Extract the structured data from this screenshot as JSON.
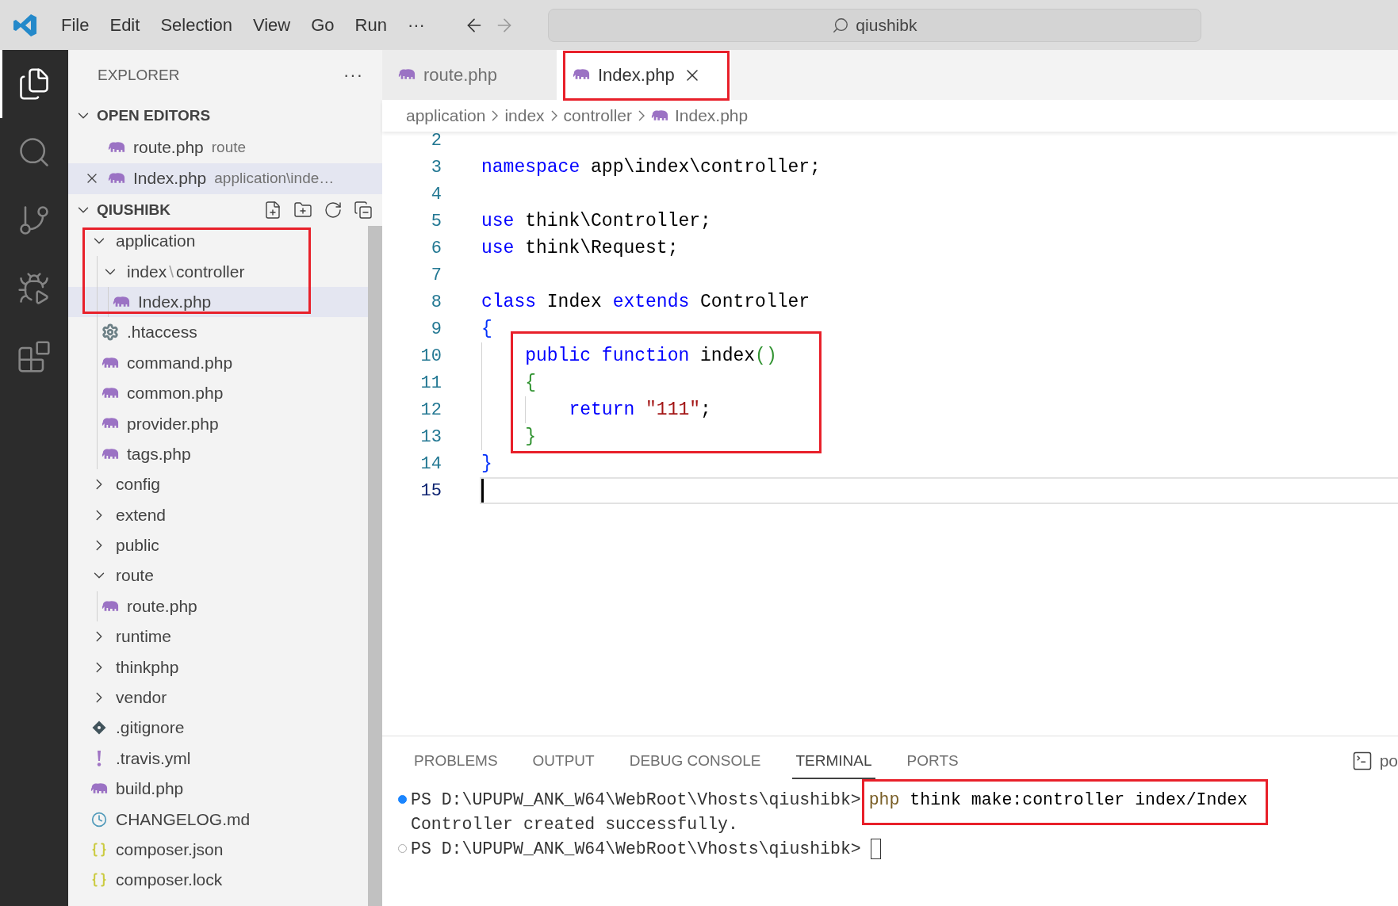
{
  "menu_bar": {
    "items": [
      "File",
      "Edit",
      "Selection",
      "View",
      "Go",
      "Run",
      "···"
    ],
    "search": {
      "value": "qiushibk"
    }
  },
  "activity_bar": [
    {
      "kind": "explorer",
      "selected": true
    },
    {
      "kind": "search",
      "selected": false
    },
    {
      "kind": "source-control",
      "selected": false
    },
    {
      "kind": "run-debug",
      "selected": false
    },
    {
      "kind": "extensions",
      "selected": false
    }
  ],
  "sidebar": {
    "title": "EXPLORER",
    "more": "···",
    "open_editors": {
      "title": "OPEN EDITORS",
      "expanded": true,
      "items": [
        {
          "name": "route.php",
          "description": "route",
          "active": false
        },
        {
          "name": "Index.php",
          "description": "application\\inde…",
          "active": true
        }
      ]
    },
    "folder": {
      "title": "QIUSHIBK",
      "expanded": true,
      "tree": [
        {
          "name": "application",
          "kind": "folder",
          "expanded": true,
          "selected": false,
          "annotated": true,
          "children": [
            {
              "segments": [
                "index",
                "\\",
                "controller"
              ],
              "kind": "folder",
              "expanded": true,
              "selected": false,
              "annotated": true,
              "children": [
                {
                  "name": "Index.php",
                  "kind": "php",
                  "selected": true,
                  "annotated": true
                }
              ]
            },
            {
              "name": ".htaccess",
              "kind": "gear",
              "selected": false,
              "annotated": false
            },
            {
              "name": "command.php",
              "kind": "php",
              "selected": false,
              "annotated": false
            },
            {
              "name": "common.php",
              "kind": "php",
              "selected": false,
              "annotated": false
            },
            {
              "name": "provider.php",
              "kind": "php",
              "selected": false,
              "annotated": false
            },
            {
              "name": "tags.php",
              "kind": "php",
              "selected": false,
              "annotated": false
            }
          ]
        },
        {
          "name": "config",
          "kind": "folder",
          "expanded": false,
          "selected": false,
          "annotated": false
        },
        {
          "name": "extend",
          "kind": "folder",
          "expanded": false,
          "selected": false,
          "annotated": false
        },
        {
          "name": "public",
          "kind": "folder",
          "expanded": false,
          "selected": false,
          "annotated": false
        },
        {
          "name": "route",
          "kind": "folder",
          "expanded": true,
          "selected": false,
          "annotated": false,
          "children": [
            {
              "name": "route.php",
              "kind": "php",
              "selected": false,
              "annotated": false
            }
          ]
        },
        {
          "name": "runtime",
          "kind": "folder",
          "expanded": false,
          "selected": false,
          "annotated": false
        },
        {
          "name": "thinkphp",
          "kind": "folder",
          "expanded": false,
          "selected": false,
          "annotated": false
        },
        {
          "name": "vendor",
          "kind": "folder",
          "expanded": false,
          "selected": false,
          "annotated": false
        },
        {
          "name": ".gitignore",
          "kind": "git",
          "selected": false,
          "annotated": false
        },
        {
          "name": ".travis.yml",
          "kind": "yml",
          "selected": false,
          "annotated": false
        },
        {
          "name": "build.php",
          "kind": "php",
          "selected": false,
          "annotated": false
        },
        {
          "name": "CHANGELOG.md",
          "kind": "clock",
          "selected": false,
          "annotated": false
        },
        {
          "name": "composer.json",
          "kind": "json",
          "selected": false,
          "annotated": false
        },
        {
          "name": "composer.lock",
          "kind": "json",
          "selected": false,
          "annotated": false
        }
      ]
    }
  },
  "editor": {
    "tabs": [
      {
        "name": "route.php",
        "selected": false,
        "annotated": false
      },
      {
        "name": "Index.php",
        "selected": true,
        "annotated": true
      }
    ],
    "breadcrumb": [
      {
        "label": "application",
        "kind": "folder"
      },
      {
        "label": "index",
        "kind": "folder"
      },
      {
        "label": "controller",
        "kind": "folder"
      },
      {
        "label": "Index.php",
        "kind": "php"
      }
    ],
    "lines": [
      {
        "number": "2",
        "current": false,
        "annotated": false
      },
      {
        "number": "3",
        "current": false,
        "annotated": false,
        "tokens": [
          {
            "text": "namespace",
            "kind": "keyword"
          },
          {
            "text": " app\\index\\controller;",
            "kind": "plain"
          }
        ]
      },
      {
        "number": "4",
        "current": false,
        "annotated": false
      },
      {
        "number": "5",
        "current": false,
        "annotated": false,
        "tokens": [
          {
            "text": "use",
            "kind": "keyword"
          },
          {
            "text": " think\\Controller;",
            "kind": "plain"
          }
        ]
      },
      {
        "number": "6",
        "current": false,
        "annotated": false,
        "tokens": [
          {
            "text": "use",
            "kind": "keyword"
          },
          {
            "text": " think\\Request;",
            "kind": "plain"
          }
        ]
      },
      {
        "number": "7",
        "current": false,
        "annotated": false
      },
      {
        "number": "8",
        "current": false,
        "annotated": false,
        "tokens": [
          {
            "text": "class",
            "kind": "keyword"
          },
          {
            "text": " Index ",
            "kind": "plain"
          },
          {
            "text": "extends",
            "kind": "keyword"
          },
          {
            "text": " Controller",
            "kind": "plain"
          }
        ]
      },
      {
        "number": "9",
        "current": false,
        "annotated": false,
        "tokens": [
          {
            "text": "{",
            "kind": "bracket1"
          }
        ]
      },
      {
        "number": "10",
        "current": false,
        "annotated": true,
        "tokens": [
          {
            "text": "    public function",
            "kind": "keyword"
          },
          {
            "text": " index",
            "kind": "plain"
          },
          {
            "text": "()",
            "kind": "bracket2"
          }
        ]
      },
      {
        "number": "11",
        "current": false,
        "annotated": true,
        "tokens": [
          {
            "text": "    {",
            "kind": "bracket2"
          }
        ]
      },
      {
        "number": "12",
        "current": false,
        "annotated": true,
        "tokens": [
          {
            "text": "        return",
            "kind": "keyword"
          },
          {
            "text": " \"111\"",
            "kind": "string"
          },
          {
            "text": ";",
            "kind": "plain"
          }
        ]
      },
      {
        "number": "13",
        "current": false,
        "annotated": true,
        "tokens": [
          {
            "text": "    }",
            "kind": "bracket2"
          }
        ]
      },
      {
        "number": "14",
        "current": false,
        "annotated": false,
        "tokens": [
          {
            "text": "}",
            "kind": "bracket1"
          }
        ]
      },
      {
        "number": "15",
        "current": true,
        "annotated": false
      }
    ]
  },
  "panel": {
    "tabs": [
      {
        "label": "PROBLEMS",
        "selected": false
      },
      {
        "label": "OUTPUT",
        "selected": false
      },
      {
        "label": "DEBUG CONSOLE",
        "selected": false
      },
      {
        "label": "TERMINAL",
        "selected": true
      },
      {
        "label": "PORTS",
        "selected": false
      }
    ],
    "shell": "po",
    "terminal": [
      {
        "kind": "prompt",
        "succeeded": true,
        "prompt": "PS D:\\UPUPW_ANK_W64\\WebRoot\\Vhosts\\qiushibk>",
        "command": [
          {
            "text": "php",
            "kind": "program"
          },
          {
            "text": " think make:controller index/Index",
            "kind": "plain"
          }
        ],
        "cursor": false,
        "annotated": true
      },
      {
        "kind": "output",
        "text": "Controller created successfully."
      },
      {
        "kind": "prompt",
        "succeeded": false,
        "prompt": "PS D:\\UPUPW_ANK_W64\\WebRoot\\Vhosts\\qiushibk>",
        "cursor": true,
        "annotated": false
      }
    ]
  }
}
